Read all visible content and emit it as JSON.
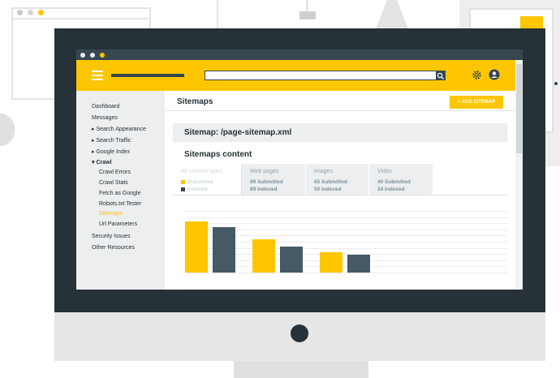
{
  "colors": {
    "accent": "#fdc600",
    "dark": "#37474f",
    "submitted": "#fdc600",
    "indexed": "#455a64"
  },
  "window_controls": [
    "close",
    "minimize",
    "maximize"
  ],
  "header": {
    "menu_icon": "hamburger-icon",
    "search_icon": "search-icon",
    "settings_icon": "gear-icon",
    "account_icon": "account-icon"
  },
  "sidebar": {
    "items": [
      {
        "label": "Dashboard",
        "level": 0
      },
      {
        "label": "Messages",
        "level": 0
      },
      {
        "label": "▸ Search Appearance",
        "level": 0
      },
      {
        "label": "▸ Search Traffic",
        "level": 0
      },
      {
        "label": "▸ Google Index",
        "level": 0
      },
      {
        "label": "▾ Crawl",
        "level": 0,
        "bold": true
      },
      {
        "label": "Crawl Errors",
        "level": 1
      },
      {
        "label": "Crawl Stats",
        "level": 1
      },
      {
        "label": "Fetch as Google",
        "level": 1
      },
      {
        "label": "Robots.txt Tester",
        "level": 1
      },
      {
        "label": "Sitemaps",
        "level": 1,
        "active": true
      },
      {
        "label": "Url Parameters",
        "level": 1
      },
      {
        "label": "Security Issues",
        "level": 0
      },
      {
        "label": "Other Resources",
        "level": 0
      }
    ]
  },
  "main": {
    "title": "Sitemaps",
    "add_button": "+ ADD SITEMAP",
    "sitemap_heading": "Sitemap: /page-sitemap.xml",
    "content_heading": "Sitemaps content"
  },
  "tabs": [
    {
      "label": "All content types",
      "submitted": "Submitted",
      "indexed": "Indexed",
      "active": true
    },
    {
      "label": "Web pages",
      "submitted": "99  Submitted",
      "indexed": "89  Indexed"
    },
    {
      "label": "Images",
      "submitted": "65  Submitted",
      "indexed": "50  Indexed"
    },
    {
      "label": "Video",
      "submitted": "40  Submitted",
      "indexed": "34  Indexed"
    }
  ],
  "chart_data": {
    "type": "bar",
    "categories": [
      "Web pages",
      "Images",
      "Video"
    ],
    "series": [
      {
        "name": "Submitted",
        "values": [
          99,
          65,
          40
        ]
      },
      {
        "name": "Indexed",
        "values": [
          89,
          50,
          34
        ]
      }
    ],
    "ylim": [
      0,
      120
    ],
    "grid": true
  }
}
